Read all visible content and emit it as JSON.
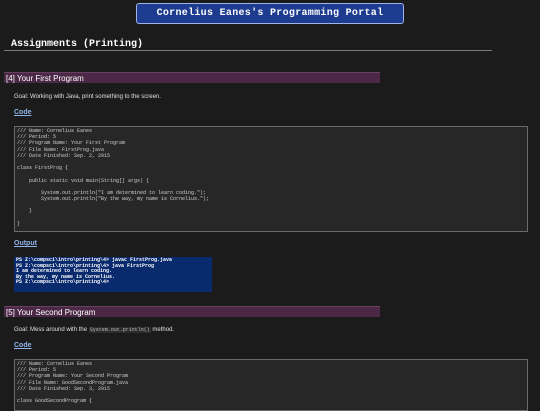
{
  "banner": {
    "title": "Cornelius Eanes's Programming Portal"
  },
  "page": {
    "heading": "Assignments (Printing)"
  },
  "assignments": [
    {
      "title": "[4] Your First Program",
      "goal_prefix": "Goal: Working with Java, print something to the screen.",
      "code_label": "Code",
      "code_lines": [
        "/// Name: Cornelius Eanes",
        "/// Period: 5",
        "/// Program Name: Your First Program",
        "/// File Name: FirstProg.java",
        "/// Date Finished: Sep. 2, 2015",
        "",
        "class FirstProg {",
        "",
        "    public static void main(String[] args) {",
        "",
        "        System.out.println(\"I am determined to learn coding.\");",
        "        System.out.println(\"By the way, my name is Cornelius.\");",
        "",
        "    }",
        "",
        "}"
      ],
      "output_label": "Output",
      "terminal_lines": [
        "PS Z:\\compsci\\intro\\printing\\4> javac FirstProg.java",
        "PS Z:\\compsci\\intro\\printing\\4> java FirstProg",
        "I am determined to learn coding.",
        "By the way, my name is Cornelius.",
        "PS Z:\\compsci\\intro\\printing\\4>"
      ]
    },
    {
      "title": "[5] Your Second Program",
      "goal_prefix": "Goal: Mess around with the",
      "goal_code": "System.out.println()",
      "goal_suffix": "method.",
      "code_label": "Code",
      "code_lines": [
        "/// Name: Cornelius Eanes",
        "/// Period: 5",
        "/// Program Name: Your Second Program",
        "/// File Name: GoodSecondProgram.java",
        "/// Date Finished: Sep. 3, 2015",
        "",
        "class GoodSecondProgram {"
      ]
    }
  ]
}
